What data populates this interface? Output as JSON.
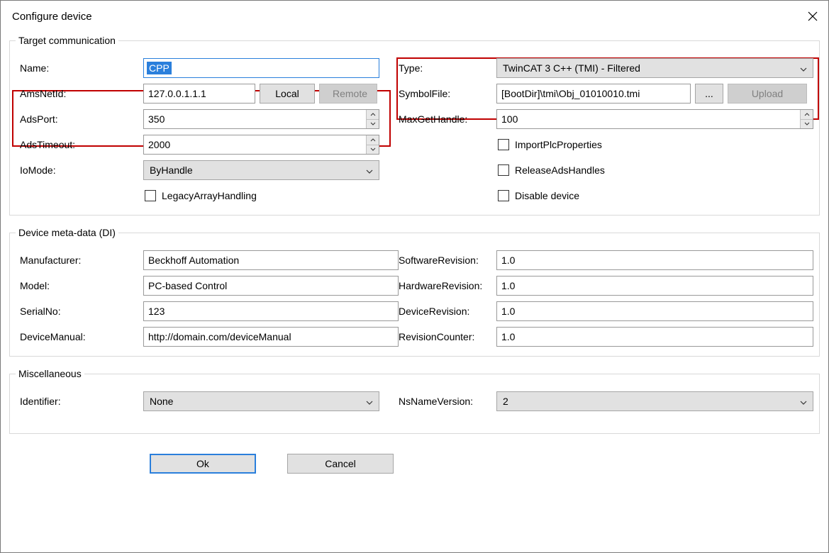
{
  "title": "Configure device",
  "groups": {
    "target": {
      "legend": "Target communication",
      "name": {
        "label": "Name:",
        "value": "CPP"
      },
      "amsnetid": {
        "label": "AmsNetId:",
        "value": "127.0.0.1.1.1",
        "local": "Local",
        "remote": "Remote"
      },
      "adsport": {
        "label": "AdsPort:",
        "value": "350"
      },
      "adstimeout": {
        "label": "AdsTimeout:",
        "value": "2000"
      },
      "iomode": {
        "label": "IoMode:",
        "value": "ByHandle"
      },
      "legacyarray": {
        "label": "LegacyArrayHandling"
      },
      "type": {
        "label": "Type:",
        "value": "TwinCAT 3 C++ (TMI) - Filtered"
      },
      "symbolfile": {
        "label": "SymbolFile:",
        "value": "[BootDir]\\tmi\\Obj_01010010.tmi",
        "browse": "...",
        "upload": "Upload"
      },
      "maxgethandle": {
        "label": "MaxGetHandle:",
        "value": "100"
      },
      "importplc": {
        "label": "ImportPlcProperties"
      },
      "releaseads": {
        "label": "ReleaseAdsHandles"
      },
      "disabledevice": {
        "label": "Disable device"
      }
    },
    "di": {
      "legend": "Device meta-data (DI)",
      "manufacturer": {
        "label": "Manufacturer:",
        "value": "Beckhoff Automation"
      },
      "model": {
        "label": "Model:",
        "value": "PC-based Control"
      },
      "serialno": {
        "label": "SerialNo:",
        "value": "123"
      },
      "devicemanual": {
        "label": "DeviceManual:",
        "value": "http://domain.com/deviceManual"
      },
      "softwarerev": {
        "label": "SoftwareRevision:",
        "value": "1.0"
      },
      "hardwarerev": {
        "label": "HardwareRevision:",
        "value": "1.0"
      },
      "devicerev": {
        "label": "DeviceRevision:",
        "value": "1.0"
      },
      "revisioncounter": {
        "label": "RevisionCounter:",
        "value": "1.0"
      }
    },
    "misc": {
      "legend": "Miscellaneous",
      "identifier": {
        "label": "Identifier:",
        "value": "None"
      },
      "nsnameversion": {
        "label": "NsNameVersion:",
        "value": "2"
      }
    }
  },
  "buttons": {
    "ok": "Ok",
    "cancel": "Cancel"
  }
}
